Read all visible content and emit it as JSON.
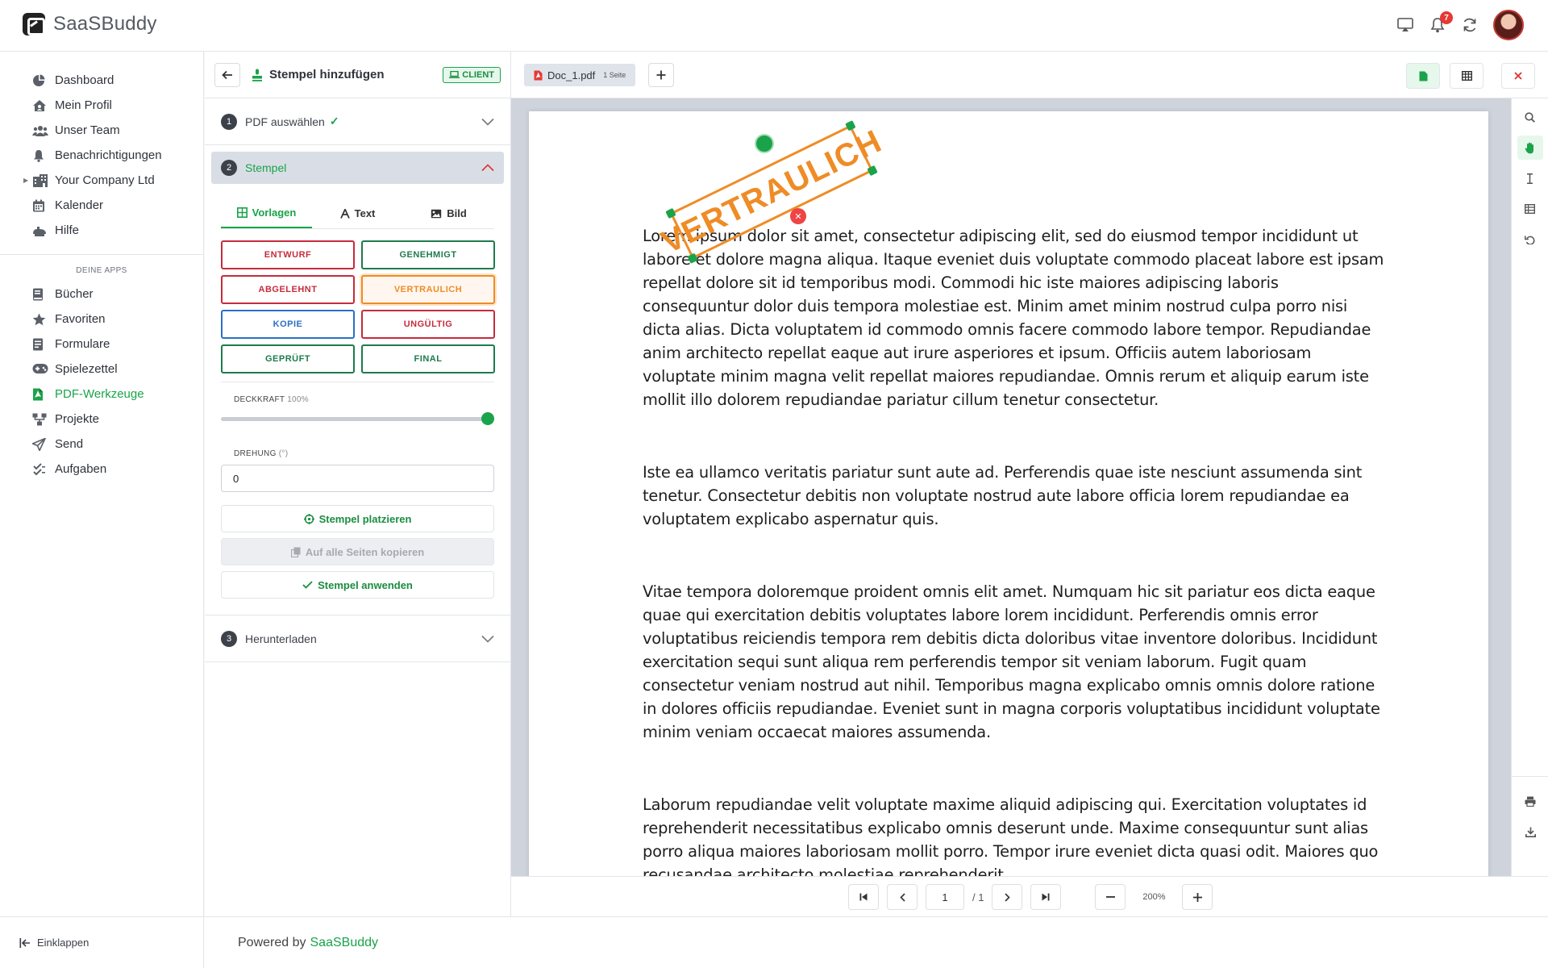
{
  "header": {
    "app_name": "SaaSBuddy",
    "notification_count": "7"
  },
  "sidebar": {
    "items": [
      {
        "label": "Dashboard",
        "icon": "dashboard-icon"
      },
      {
        "label": "Mein Profil",
        "icon": "home-user-icon"
      },
      {
        "label": "Unser Team",
        "icon": "team-icon"
      },
      {
        "label": "Benachrichtigungen",
        "icon": "bell-icon"
      },
      {
        "label": "Your Company Ltd",
        "icon": "building-icon"
      },
      {
        "label": "Kalender",
        "icon": "calendar-icon"
      },
      {
        "label": "Hilfe",
        "icon": "help-icon"
      }
    ],
    "section_label": "DEINE APPS",
    "apps": [
      {
        "label": "Bücher",
        "icon": "book-icon"
      },
      {
        "label": "Favoriten",
        "icon": "star-icon"
      },
      {
        "label": "Formulare",
        "icon": "form-icon"
      },
      {
        "label": "Spielezettel",
        "icon": "gamepad-icon"
      },
      {
        "label": "PDF-Werkzeuge",
        "icon": "pdf-icon",
        "active": true
      },
      {
        "label": "Projekte",
        "icon": "project-icon"
      },
      {
        "label": "Send",
        "icon": "send-icon"
      },
      {
        "label": "Aufgaben",
        "icon": "tasks-icon"
      }
    ],
    "collapse_label": "Einklappen"
  },
  "panel": {
    "title": "Stempel hinzufügen",
    "client_badge": "CLIENT",
    "step1": {
      "num": "1",
      "label": "PDF auswählen"
    },
    "step2": {
      "num": "2",
      "label": "Stempel"
    },
    "step3": {
      "num": "3",
      "label": "Herunterladen"
    },
    "tabs": {
      "templates": "Vorlagen",
      "text": "Text",
      "image": "Bild"
    },
    "stamps": [
      {
        "label": "ENTWURF",
        "color": "red"
      },
      {
        "label": "GENEHMIGT",
        "color": "green"
      },
      {
        "label": "ABGELEHNT",
        "color": "red"
      },
      {
        "label": "VERTRAULICH",
        "color": "orange"
      },
      {
        "label": "KOPIE",
        "color": "blue"
      },
      {
        "label": "UNGÜLTIG",
        "color": "red"
      },
      {
        "label": "GEPRÜFT",
        "color": "green"
      },
      {
        "label": "FINAL",
        "color": "green"
      }
    ],
    "opacity_label": "DECKKRAFT",
    "opacity_value": "100%",
    "opacity_fraction": 1.0,
    "rotation_label": "DREHUNG",
    "rotation_unit": "(°)",
    "rotation_value": "0",
    "place_label": "Stempel platzieren",
    "copy_label": "Auf alle Seiten kopieren",
    "apply_label": "Stempel anwenden"
  },
  "document": {
    "tab_name": "Doc_1.pdf",
    "tab_pages": "1 Seite",
    "stamp_text": "VERTRAULICH",
    "paragraphs": [
      "Lorem ipsum dolor sit amet, consectetur adipiscing elit, sed do eiusmod tempor incididunt ut labore et dolore magna aliqua. Itaque eveniet duis voluptate commodo placeat labore est ipsam repellat dolore sit id temporibus modi. Commodi hic iste maiores adipiscing laboris consequuntur dolor duis tempora molestiae est. Minim amet minim nostrud culpa porro nisi dicta alias. Dicta voluptatem id commodo omnis facere commodo labore tempor. Repudiandae anim architecto repellat eaque aut irure asperiores et ipsum. Officiis autem laboriosam voluptate minim magna velit repellat maiores repudiandae. Omnis rerum et aliquip earum iste mollit illo dolorem repudiandae pariatur cillum tenetur consectetur.",
      "Iste ea ullamco veritatis pariatur sunt aute ad. Perferendis quae iste nesciunt assumenda sint tenetur. Consectetur debitis non voluptate nostrud aute labore officia lorem repudiandae ea voluptatem explicabo aspernatur quis.",
      "Vitae tempora doloremque proident omnis elit amet. Numquam hic sit pariatur eos dicta eaque quae qui exercitation debitis voluptates labore lorem incididunt. Perferendis omnis error voluptatibus reiciendis tempora rem debitis dicta doloribus vitae inventore doloribus. Incididunt exercitation sequi sunt aliqua rem perferendis tempor sit veniam laborum. Fugit quam consectetur veniam nostrud aut nihil. Temporibus magna explicabo omnis omnis dolore ratione in dolores officiis repudiandae. Eveniet sunt in magna corporis voluptatibus incididunt voluptate minim veniam occaecat maiores assumenda.",
      "Laborum repudiandae velit voluptate maxime aliquid adipiscing qui. Exercitation voluptates id reprehenderit necessitatibus explicabo omnis deserunt unde. Maxime consequuntur sunt alias porro aliqua maiores laboriosam mollit porro. Tempor irure eveniet dicta quasi odit. Maiores quo recusandae architecto molestiae reprehenderit."
    ]
  },
  "pager": {
    "current_page": "1",
    "total": "/ 1",
    "zoom": "200%"
  },
  "footer": {
    "powered_by": "Powered by",
    "brand": "SaaSBuddy"
  },
  "colors": {
    "accent": "#1aa34a",
    "danger": "#d33",
    "stamp_orange": "#ef8c26"
  }
}
